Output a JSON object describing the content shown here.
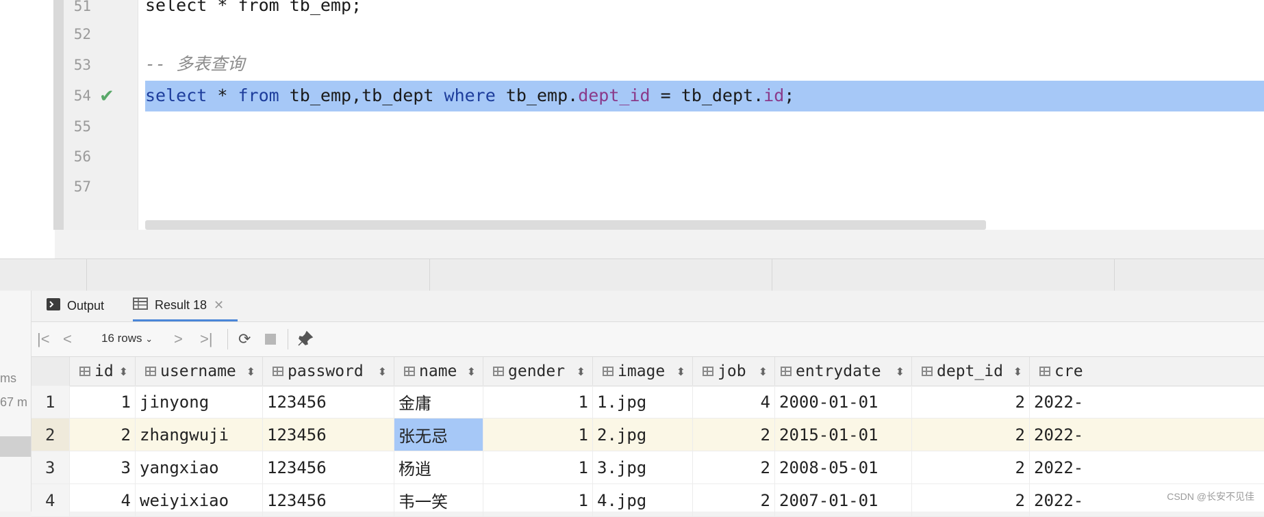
{
  "editor": {
    "lines": [
      {
        "num": "51",
        "code": "select * from tb_emp;"
      },
      {
        "num": "52",
        "code": ""
      },
      {
        "num": "53",
        "code": "-- 多表查询"
      },
      {
        "num": "54",
        "code_parts": [
          "select",
          " * ",
          "from",
          " tb_emp,tb_dept ",
          "where",
          " tb_emp.",
          "dept_id",
          " = tb_dept.",
          "id",
          ";"
        ]
      },
      {
        "num": "55",
        "code": ""
      },
      {
        "num": "56",
        "code": ""
      },
      {
        "num": "57",
        "code": ""
      }
    ],
    "check_mark": "✔"
  },
  "side_panel": {
    "line1": "ms",
    "line2": "67 m"
  },
  "tabs": [
    {
      "label": "Output",
      "icon": "terminal-icon"
    },
    {
      "label": "Result 18",
      "icon": "table-icon"
    }
  ],
  "toolbar": {
    "rows_label": "16 rows",
    "first": "|<",
    "prev": "<",
    "next": ">",
    "last": ">|",
    "refresh_icon": "refresh-icon",
    "stop_icon": "stop-icon",
    "pin_icon": "pin-icon"
  },
  "grid": {
    "columns": [
      "id",
      "username",
      "password",
      "name",
      "gender",
      "image",
      "job",
      "entrydate",
      "dept_id",
      "cre"
    ],
    "rows": [
      {
        "rownum": "1",
        "id": "1",
        "username": "jinyong",
        "password": "123456",
        "name": "金庸",
        "gender": "1",
        "image": "1.jpg",
        "job": "4",
        "entrydate": "2000-01-01",
        "dept_id": "2",
        "cre": "2022-"
      },
      {
        "rownum": "2",
        "id": "2",
        "username": "zhangwuji",
        "password": "123456",
        "name": "张无忌",
        "gender": "1",
        "image": "2.jpg",
        "job": "2",
        "entrydate": "2015-01-01",
        "dept_id": "2",
        "cre": "2022-"
      },
      {
        "rownum": "3",
        "id": "3",
        "username": "yangxiao",
        "password": "123456",
        "name": "杨逍",
        "gender": "1",
        "image": "3.jpg",
        "job": "2",
        "entrydate": "2008-05-01",
        "dept_id": "2",
        "cre": "2022-"
      },
      {
        "rownum": "4",
        "id": "4",
        "username": "weiyixiao",
        "password": "123456",
        "name": "韦一笑",
        "gender": "1",
        "image": "4.jpg",
        "job": "2",
        "entrydate": "2007-01-01",
        "dept_id": "2",
        "cre": "2022-"
      }
    ]
  },
  "watermark": "CSDN @长安不见佳",
  "colors": {
    "selection": "#a6c8f7",
    "keyword": "#1d3d9c",
    "column_ref": "#8a3a8a",
    "check": "#59a869"
  }
}
